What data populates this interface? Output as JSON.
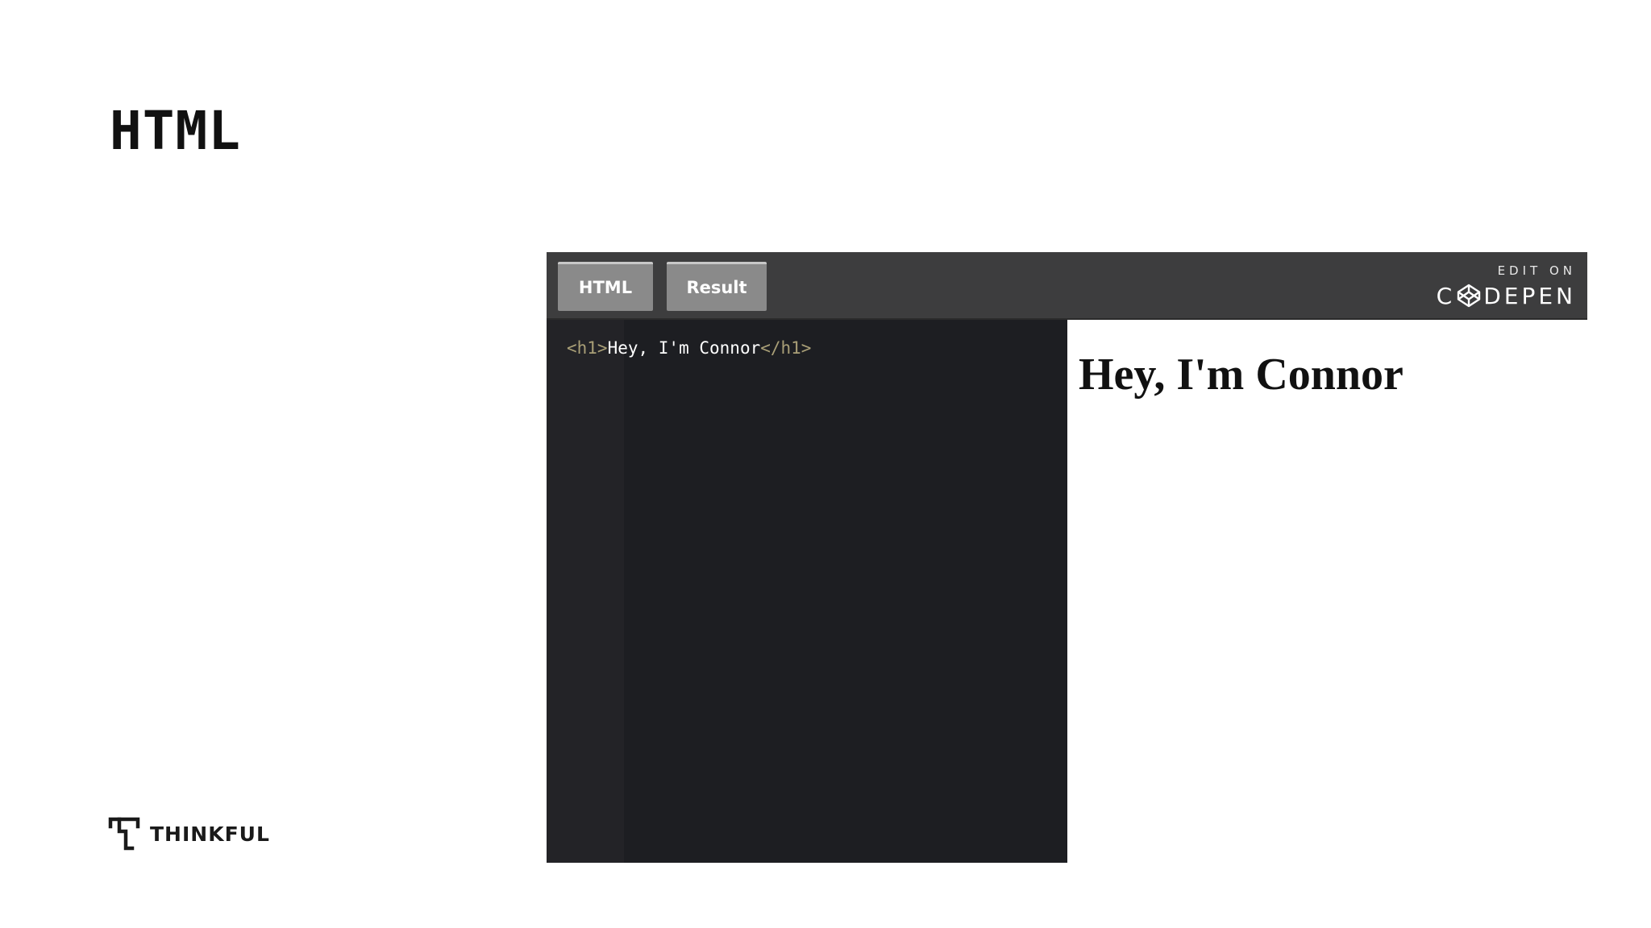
{
  "slide": {
    "title": "HTML"
  },
  "embed": {
    "tabs": [
      {
        "label": "HTML"
      },
      {
        "label": "Result"
      }
    ],
    "edit_on_label": "EDIT ON",
    "codepen_left": "C",
    "codepen_right": "DEPEN",
    "code": {
      "open_tag": "<h1>",
      "text": "Hey, I'm Connor",
      "close_tag": "</h1>"
    },
    "result": {
      "heading": "Hey, I'm Connor"
    }
  },
  "brand": {
    "name": "THINKFUL",
    "icon": "thinkful-logo-icon"
  },
  "colors": {
    "header_bg": "#3d3d3e",
    "tab_bg": "#8a8a8a",
    "code_bg": "#1d1e22",
    "tag_color": "#a99f77"
  }
}
